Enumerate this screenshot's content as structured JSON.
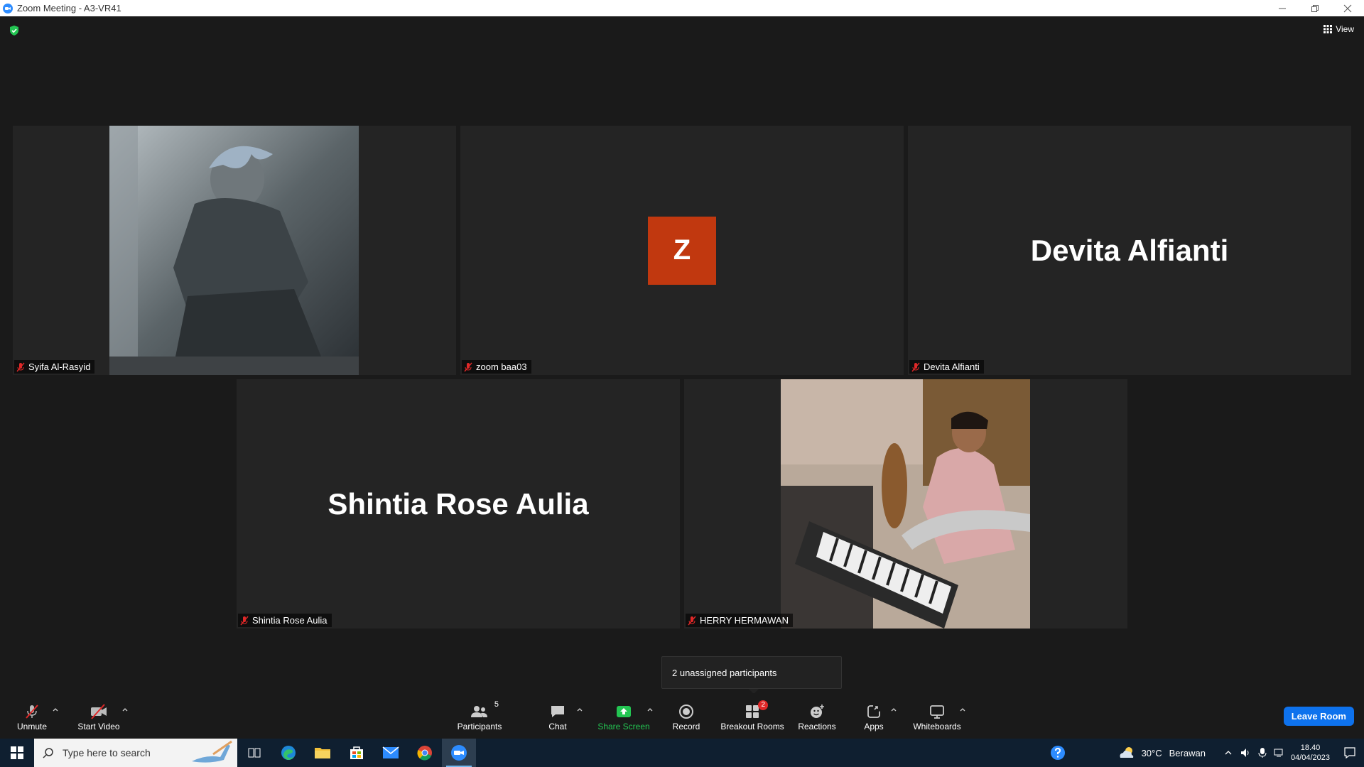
{
  "window": {
    "title": "Zoom Meeting - A3-VR41"
  },
  "topbar": {
    "view_label": "View"
  },
  "tiles": [
    {
      "name": "Syifa Al-Rasyid",
      "type": "video"
    },
    {
      "name": "zoom baa03",
      "type": "avatar",
      "initial": "Z"
    },
    {
      "name": "Devita Alfianti",
      "type": "name",
      "display": "Devita Alfianti"
    },
    {
      "name": "Shintia Rose Aulia",
      "type": "name",
      "display": "Shintia Rose Aulia"
    },
    {
      "name": "HERRY HERMAWAN",
      "type": "video"
    }
  ],
  "tooltip": {
    "text": "2 unassigned participants"
  },
  "toolbar": {
    "unmute": "Unmute",
    "start_video": "Start Video",
    "participants": "Participants",
    "participants_count": "5",
    "chat": "Chat",
    "share_screen": "Share Screen",
    "record": "Record",
    "breakout_rooms": "Breakout Rooms",
    "breakout_badge": "2",
    "reactions": "Reactions",
    "apps": "Apps",
    "whiteboards": "Whiteboards",
    "leave": "Leave Room"
  },
  "taskbar": {
    "search_placeholder": "Type here to search",
    "weather_temp": "30°C",
    "weather_desc": "Berawan",
    "time": "18.40",
    "date": "04/04/2023"
  },
  "colors": {
    "accent": "#0e72ed",
    "avatar": "#c1380f",
    "share": "#23c552",
    "badge": "#e02828"
  }
}
